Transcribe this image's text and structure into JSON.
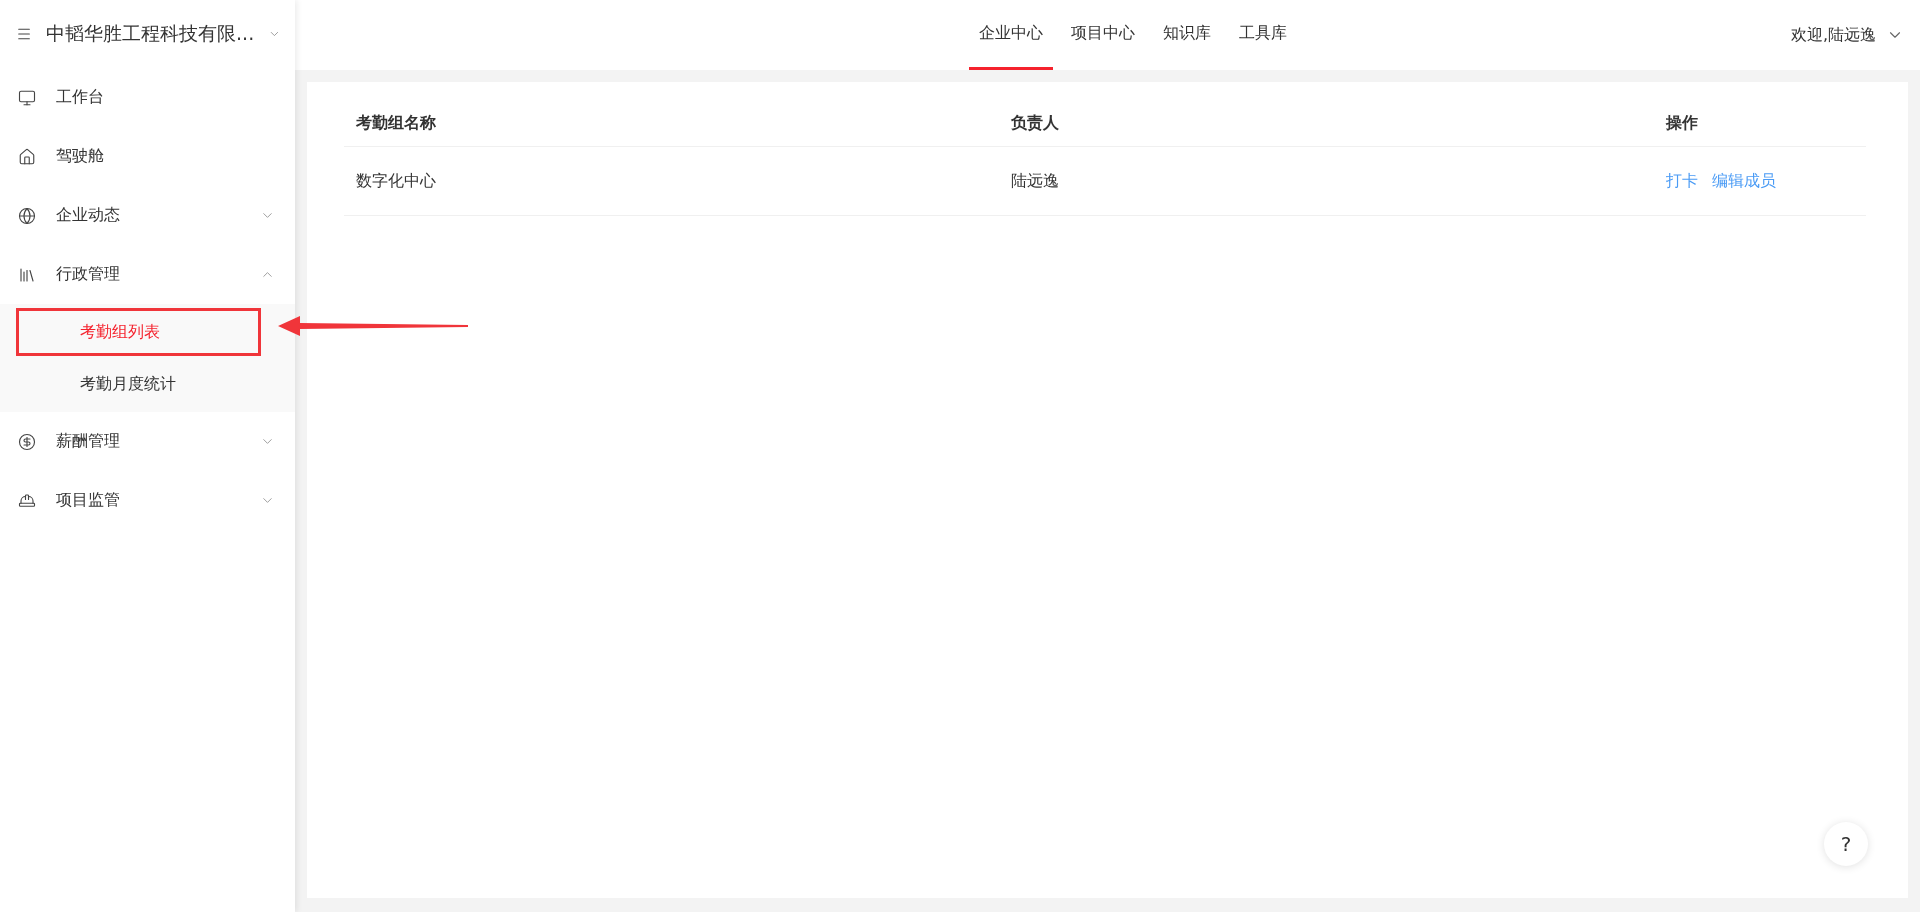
{
  "sidebar": {
    "company": "中韬华胜工程科技有限...",
    "items": [
      {
        "label": "工作台",
        "kind": "link"
      },
      {
        "label": "驾驶舱",
        "kind": "link"
      },
      {
        "label": "企业动态",
        "kind": "group",
        "expanded": false
      },
      {
        "label": "行政管理",
        "kind": "group",
        "expanded": true,
        "children": [
          {
            "label": "考勤组列表",
            "selected": true
          },
          {
            "label": "考勤月度统计",
            "selected": false
          }
        ]
      },
      {
        "label": "薪酬管理",
        "kind": "group",
        "expanded": false
      },
      {
        "label": "项目监管",
        "kind": "group",
        "expanded": false
      }
    ]
  },
  "top_nav": {
    "tabs": [
      {
        "label": "企业中心",
        "selected": true
      },
      {
        "label": "项目中心",
        "selected": false
      },
      {
        "label": "知识库",
        "selected": false
      },
      {
        "label": "工具库",
        "selected": false
      }
    ],
    "user": "欢迎,陆远逸"
  },
  "table": {
    "columns": [
      "考勤组名称",
      "负责人",
      "操作"
    ],
    "rows": [
      {
        "name": "数字化中心",
        "owner": "陆远逸",
        "actions": [
          "打卡",
          "编辑成员"
        ]
      }
    ]
  },
  "help_button": "?"
}
